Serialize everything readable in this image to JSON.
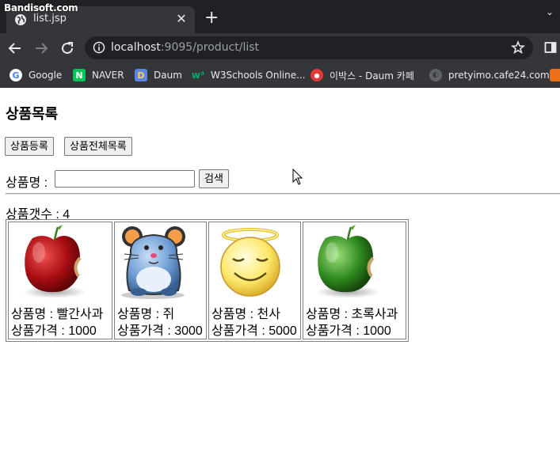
{
  "watermark": "Bandisoft.com",
  "browser": {
    "tab": {
      "title": "list.jsp",
      "close": "✕"
    },
    "new_tab": "+",
    "tab_search": "⌄",
    "address": {
      "host": "localhost",
      "rest": ":9095/product/list"
    },
    "bookmarks": [
      {
        "label": "Google",
        "icon": "google-icon"
      },
      {
        "label": "NAVER",
        "icon": "naver-icon"
      },
      {
        "label": "Daum",
        "icon": "daum-icon"
      },
      {
        "label": "W3Schools Online...",
        "icon": "w3schools-icon"
      },
      {
        "label": "이박스 - Daum 카페",
        "icon": "daum-cafe-icon"
      },
      {
        "label": "pretyimo.cafe24.com",
        "icon": "globe-icon"
      }
    ]
  },
  "page": {
    "title": "상품목록",
    "buttons": {
      "register": "상품등록",
      "list_all": "상품전체목록"
    },
    "search": {
      "label": "상품명 :",
      "value": "",
      "button": "검색"
    },
    "count_label": "상품갯수 : 4",
    "products": [
      {
        "name_line": "상품명 : 빨간사과",
        "price_line": "상품가격 : 1000",
        "image": "red-apple"
      },
      {
        "name_line": "상품명 : 쥐",
        "price_line": "상품가격 : 3000",
        "image": "mouse"
      },
      {
        "name_line": "상품명 : 천사",
        "price_line": "상품가격 : 5000",
        "image": "angel"
      },
      {
        "name_line": "상품명 : 초록사과",
        "price_line": "상품가격 : 1000",
        "image": "green-apple"
      }
    ]
  },
  "colors": {
    "chrome_dark": "#202124",
    "chrome_toolbar": "#35363a",
    "text_light": "#e8eaed",
    "text_dim": "#9aa0a6"
  }
}
